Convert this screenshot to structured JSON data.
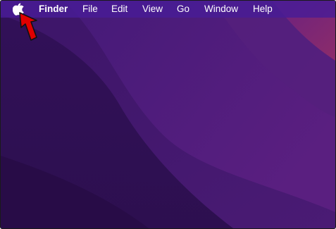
{
  "menubar": {
    "apple_icon": "apple-logo-icon",
    "app_name": "Finder",
    "items": [
      "File",
      "Edit",
      "View",
      "Go",
      "Window",
      "Help"
    ]
  },
  "annotation": {
    "icon": "red-arrow-pointer-icon",
    "color": "#e00000",
    "target": "apple-menu"
  },
  "colors": {
    "menubar": "#4a1c95",
    "wallpaper_dark": "#2f1052",
    "wallpaper_mid": "#4b1a75",
    "wallpaper_accent": "#8a2a70"
  }
}
